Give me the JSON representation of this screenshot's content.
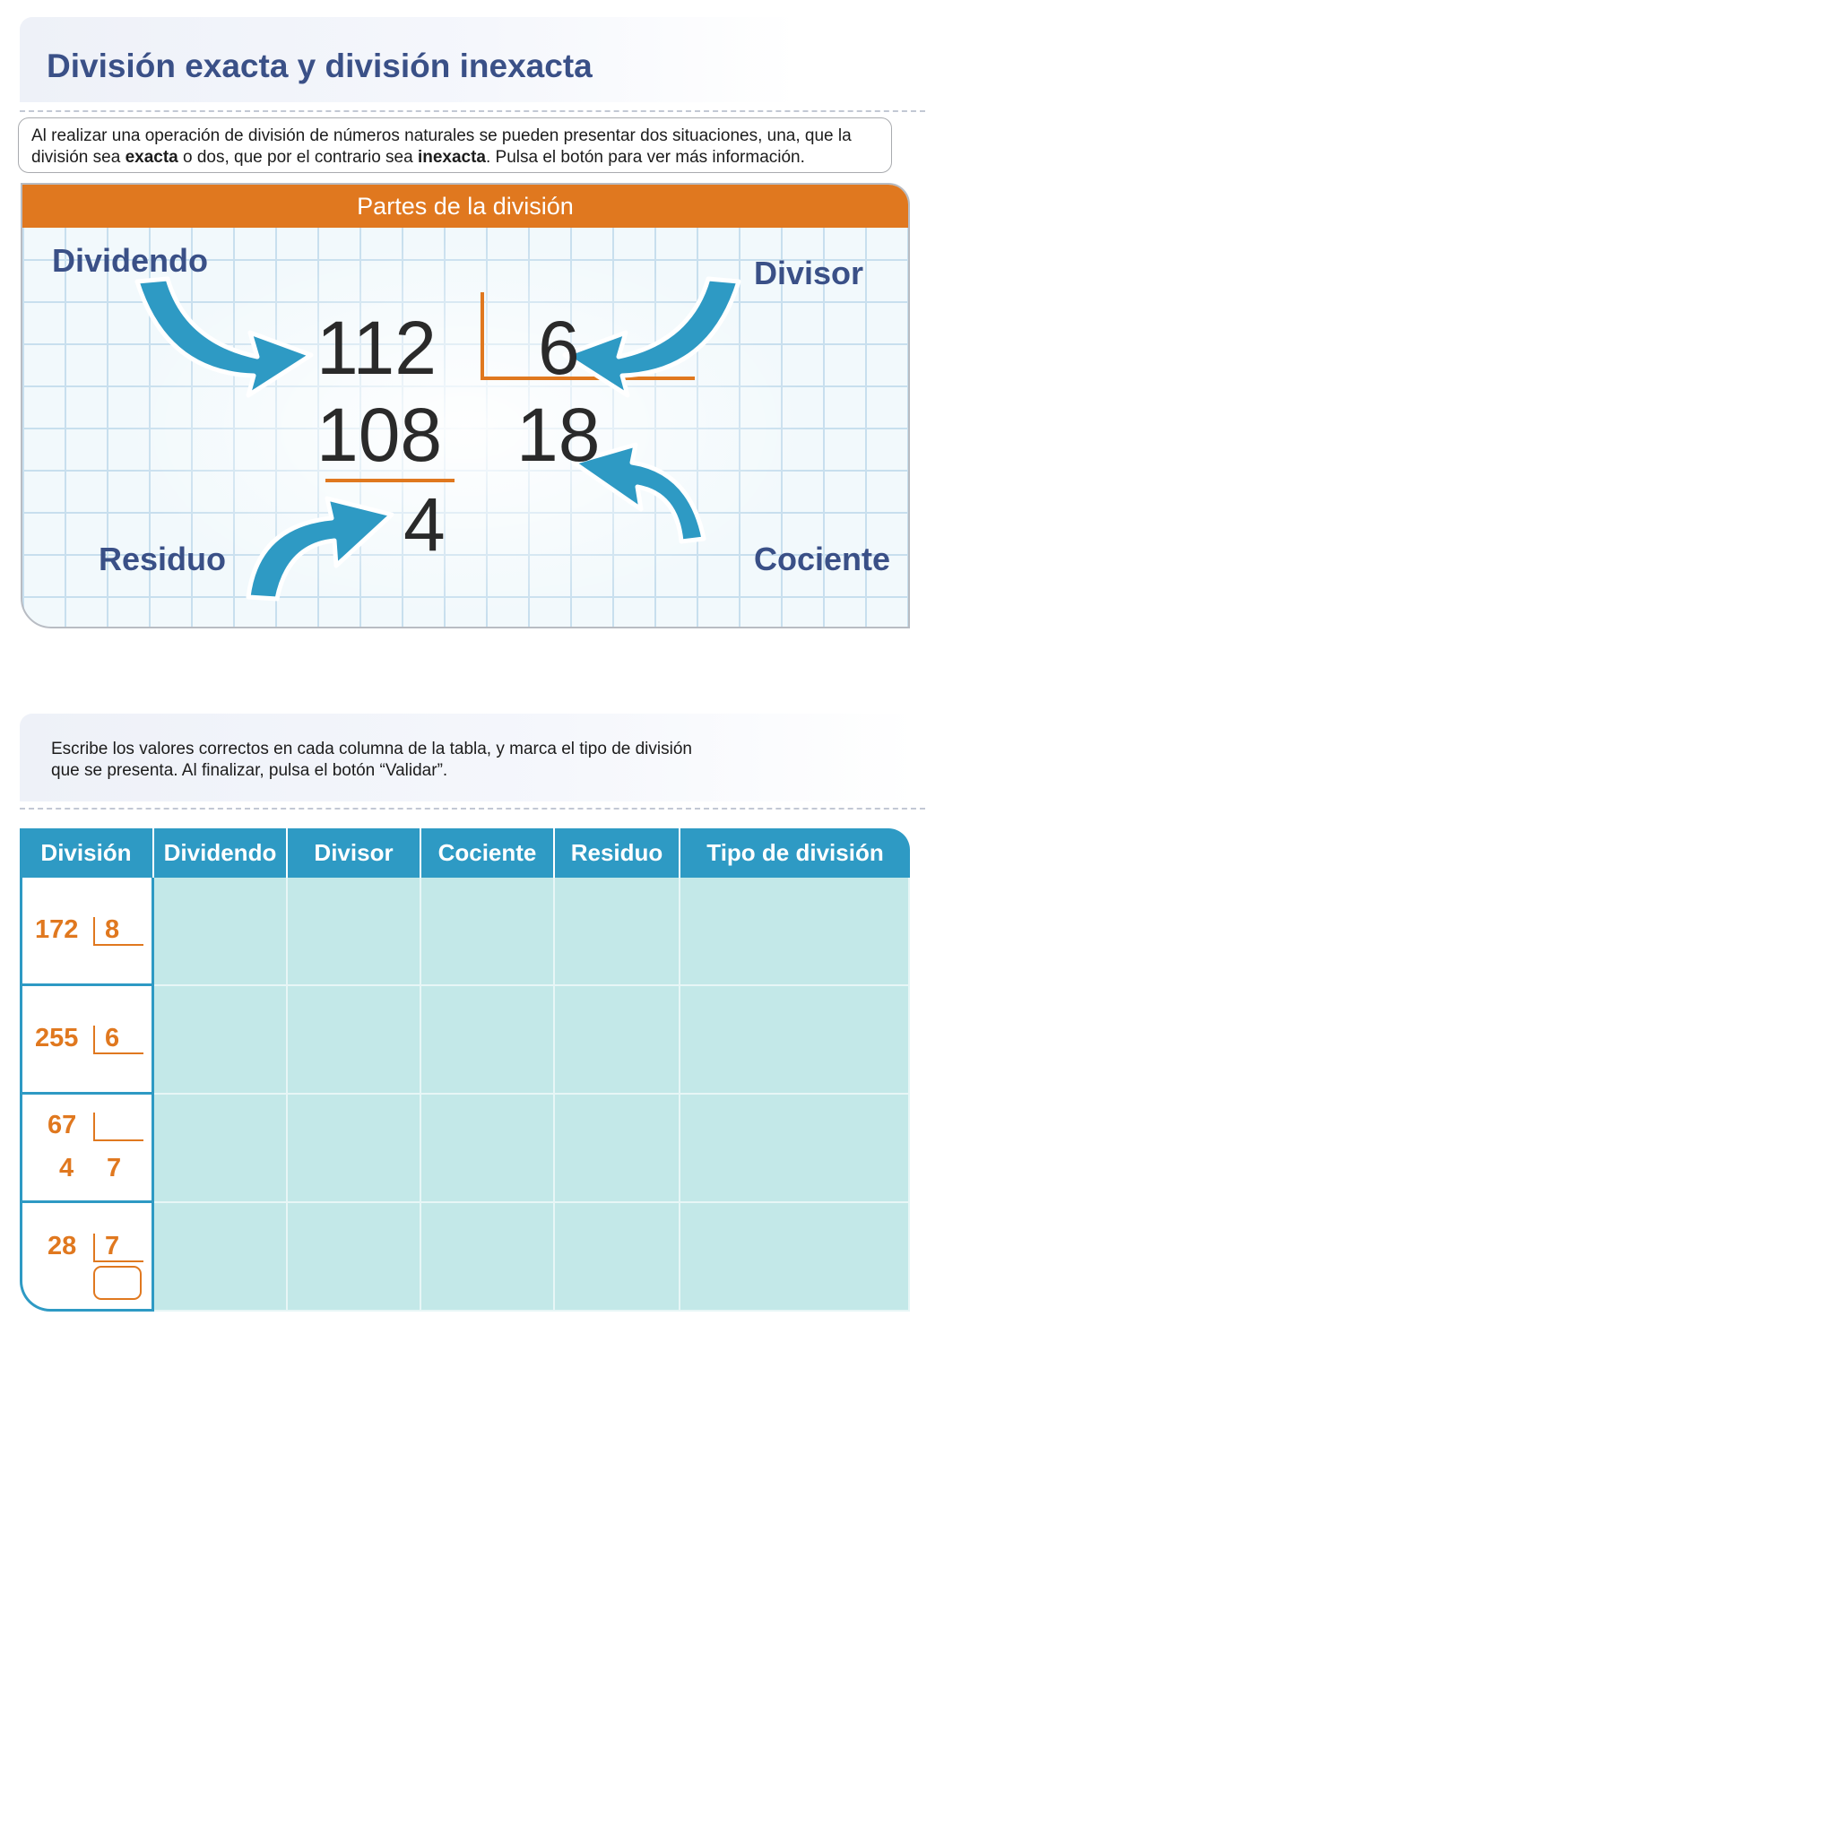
{
  "title": "División exacta y división inexacta",
  "intro": {
    "part1": "Al realizar una operación de división de números naturales se pueden presentar dos situaciones, una, que la división sea ",
    "exacta": "exacta",
    "part2": " o dos, que por el contrario sea ",
    "inexacta": "inexacta",
    "part3": ". Pulsa el botón para ver más información."
  },
  "parts_panel": {
    "header": "Partes de la división",
    "labels": {
      "dividendo": "Dividendo",
      "divisor": "Divisor",
      "residuo": "Residuo",
      "cociente": "Cociente"
    },
    "example": {
      "dividend": "112",
      "divisor": "6",
      "product": "108",
      "quotient": "18",
      "remainder": "4"
    },
    "colors": {
      "arrow": "#2e9ac4",
      "line": "#e0781f",
      "label": "#3a5087"
    }
  },
  "instructions": "Escribe los valores correctos en cada columna de la tabla, y marca el tipo de división que se presenta. Al finalizar, pulsa el botón “Validar”.",
  "table": {
    "headers": [
      "División",
      "Dividendo",
      "Divisor",
      "Cociente",
      "Residuo",
      "Tipo de división"
    ],
    "rows": [
      {
        "dividend": "172",
        "divisor": "8",
        "remainder": "",
        "quotient": ""
      },
      {
        "dividend": "255",
        "divisor": "6",
        "remainder": "",
        "quotient": ""
      },
      {
        "dividend": "67",
        "divisor": "",
        "remainder": "4",
        "quotient": "7"
      },
      {
        "dividend": "28",
        "divisor": "7",
        "remainder": "",
        "quotient": ""
      }
    ],
    "colors": {
      "header_bg": "#2e9ac4",
      "cell_bg": "#c3e8e8",
      "number": "#e0781f"
    }
  }
}
